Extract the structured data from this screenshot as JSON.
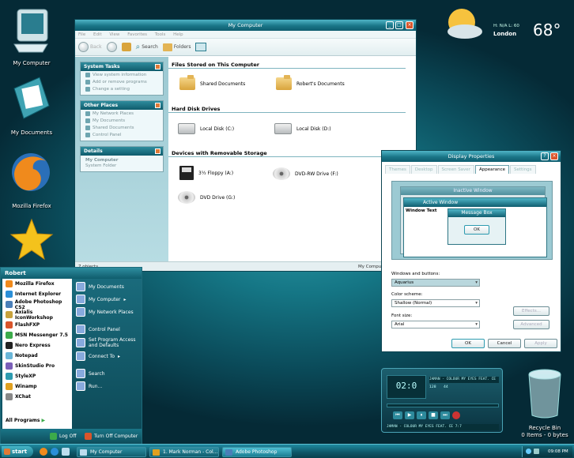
{
  "desktop": {
    "icons": [
      {
        "label": "My Computer"
      },
      {
        "label": "My Documents"
      },
      {
        "label": "Mozilla Firefox"
      },
      {
        "label": ""
      }
    ],
    "recycle_bin": {
      "label": "Recycle Bin",
      "status": "0 Items - 0 bytes"
    }
  },
  "weather": {
    "hnal": "H: N/A L: 60",
    "city": "London",
    "temp": "68°"
  },
  "explorer": {
    "title": "My Computer",
    "menu": [
      "File",
      "Edit",
      "View",
      "Favorites",
      "Tools",
      "Help"
    ],
    "toolbar": {
      "back": "Back",
      "search": "Search",
      "folders": "Folders"
    },
    "system_tasks": {
      "header": "System Tasks",
      "items": [
        "View system information",
        "Add or remove programs",
        "Change a setting"
      ]
    },
    "other_places": {
      "header": "Other Places",
      "items": [
        "My Network Places",
        "My Documents",
        "Shared Documents",
        "Control Panel"
      ]
    },
    "details": {
      "header": "Details",
      "name": "My Computer",
      "type": "System Folder"
    },
    "groups": {
      "files": "Files Stored on This Computer",
      "hdd": "Hard Disk Drives",
      "removable": "Devices with Removable Storage"
    },
    "items": {
      "shared": "Shared Documents",
      "roberts": "Robert's Documents",
      "c": "Local Disk (C:)",
      "d": "Local Disk (D:)",
      "floppy": "3½ Floppy (A:)",
      "dvdrw": "DVD-RW Drive (F:)",
      "dvd": "DVD Drive (G:)"
    },
    "status_left": "7 objects",
    "status_right": "My Computer"
  },
  "display_props": {
    "title": "Display Properties",
    "tabs": [
      "Themes",
      "Desktop",
      "Screen Saver",
      "Appearance",
      "Settings"
    ],
    "active_tab": "Appearance",
    "preview": {
      "inactive": "Inactive Window",
      "active": "Active Window",
      "window_text": "Window Text",
      "message_box": "Message Box",
      "ok": "OK"
    },
    "windows_buttons_label": "Windows and buttons:",
    "windows_buttons_value": "Aquarius",
    "color_scheme_label": "Color scheme:",
    "color_scheme_value": "Shallow (Normal)",
    "font_size_label": "Font size:",
    "font_size_value": "Arial",
    "effects": "Effects...",
    "advanced": "Advanced",
    "ok": "OK",
    "cancel": "Cancel",
    "apply": "Apply"
  },
  "winamp": {
    "display": "JAMAN - COLOUR MY EYES FEAT. CE",
    "time": "02:0",
    "bitrate": "128",
    "khz": "44",
    "bottom": "JAMAN - COLOUR MY EYES FEAT. CE 7:7"
  },
  "start_menu": {
    "user": "Robert",
    "left": [
      "Mozilla Firefox",
      "Internet Explorer",
      "Adobe Photoshop CS2",
      "Axialis IconWorkshop",
      "FlashFXP",
      "MSN Messenger 7.5",
      "Nero Express",
      "Notepad",
      "SkinStudio Pro",
      "StyleXP",
      "Winamp",
      "XChat"
    ],
    "all_programs": "All Programs",
    "right": [
      "My Documents",
      "My Computer",
      "My Network Places",
      "Control Panel",
      "Set Program Access and Defaults",
      "Connect To",
      "Search",
      "Run..."
    ],
    "log_off": "Log Off",
    "turn_off": "Turn Off Computer"
  },
  "taskbar": {
    "start": "start",
    "tasks": [
      "My Computer",
      "1. Mark Norman - Col...",
      "Adobe Photoshop"
    ],
    "clock": "09:08 PM"
  }
}
